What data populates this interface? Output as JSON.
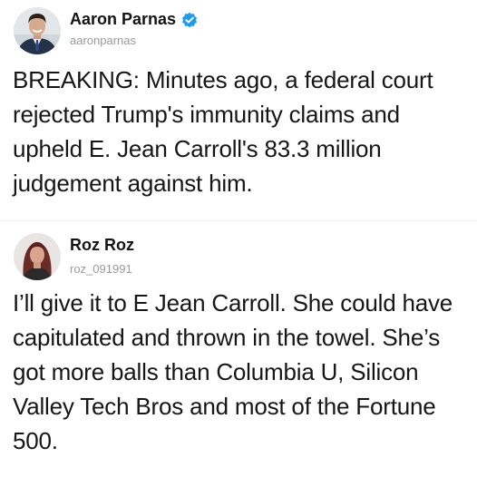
{
  "posts": [
    {
      "display_name": "Aaron Parnas",
      "handle": "aaronparnas",
      "verified": true,
      "avatar_icon": "person-photo-icon",
      "text": "BREAKING: Minutes ago, a federal court rejected Trump's immunity claims and upheld E. Jean Carroll's 83.3 million judgement against him."
    },
    {
      "display_name": "Roz Roz",
      "handle": "roz_091991",
      "verified": false,
      "avatar_icon": "person-photo-icon",
      "text": "I’ll give it to E Jean Carroll. She could have capitulated and thrown in the towel. She’s got more balls than Columbia U, Silicon Valley Tech Bros and most of the Fortune 500."
    }
  ],
  "colors": {
    "verified_blue": "#1d9bf0",
    "handle_gray": "#9a9a9a"
  }
}
